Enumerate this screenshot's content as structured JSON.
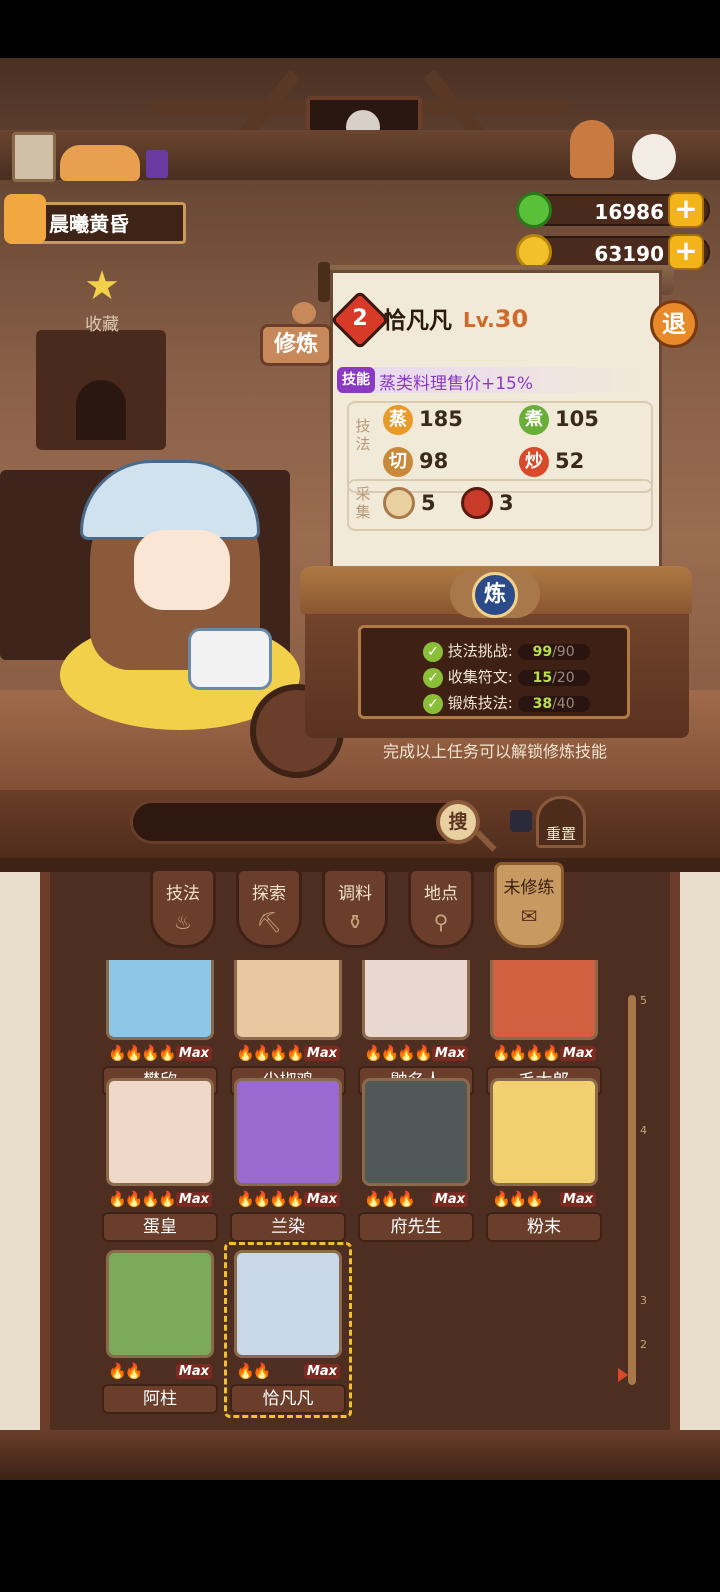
{
  "player": {
    "time_label": "晨曦黄昏"
  },
  "resources": {
    "jade": "16986",
    "coins": "63190",
    "add_symbol": "+"
  },
  "side": {
    "favorite_label": "收藏"
  },
  "header": {
    "train_tab": "修炼",
    "exit_label": "退"
  },
  "chef": {
    "rank": "2",
    "name": "恰凡凡",
    "level_prefix": "Lv.",
    "level": "30",
    "skill_tag": "技能",
    "skill_desc": "蒸类料理售价+15%",
    "technique_label": "技法",
    "collect_label": "采集",
    "stats": [
      {
        "glyph": "蒸",
        "value": "185",
        "color": "#e89a2a"
      },
      {
        "glyph": "煮",
        "value": "105",
        "color": "#6aae3a"
      },
      {
        "glyph": "切",
        "value": "98",
        "color": "#c88a3a"
      },
      {
        "glyph": "炒",
        "value": "52",
        "color": "#d84a2a"
      }
    ],
    "collect": [
      {
        "value": "5"
      },
      {
        "value": "3"
      }
    ]
  },
  "refine": {
    "button": "炼",
    "tasks": [
      {
        "label": "技法挑战:",
        "cur": "99",
        "max": "/90"
      },
      {
        "label": "收集符文:",
        "cur": "15",
        "max": "/20"
      },
      {
        "label": "锻炼技法:",
        "cur": "38",
        "max": "/40"
      }
    ],
    "hint": "完成以上任务可以解锁修炼技能"
  },
  "search": {
    "button": "搜",
    "reset": "重置"
  },
  "tabs": [
    {
      "label": "技法",
      "icon": "♨"
    },
    {
      "label": "探索",
      "icon": "⛏"
    },
    {
      "label": "调料",
      "icon": "⚱"
    },
    {
      "label": "地点",
      "icon": "⚲"
    },
    {
      "label": "未修练",
      "icon": "✉"
    }
  ],
  "rail_ticks": [
    "5",
    "4",
    "3",
    "2"
  ],
  "cards": [
    {
      "name": "樊欣",
      "flames": "🔥🔥🔥🔥",
      "max": "Max",
      "bg": "#8ec6e8"
    },
    {
      "name": "尖椒鸡",
      "flames": "🔥🔥🔥🔥",
      "max": "Max",
      "bg": "#e8c6a0"
    },
    {
      "name": "鼬名人",
      "flames": "🔥🔥🔥🔥",
      "max": "Max",
      "bg": "#e8d8d0"
    },
    {
      "name": "毛太郎",
      "flames": "🔥🔥🔥🔥",
      "max": "Max",
      "bg": "#d06040"
    },
    {
      "name": "蛋皇",
      "flames": "🔥🔥🔥🔥",
      "max": "Max",
      "bg": "#f0d8c8"
    },
    {
      "name": "兰染",
      "flames": "🔥🔥🔥🔥",
      "max": "Max",
      "bg": "#9a6ad0"
    },
    {
      "name": "府先生",
      "flames": "🔥🔥🔥",
      "max": "Max",
      "bg": "#505858"
    },
    {
      "name": "粉末",
      "flames": "🔥🔥🔥",
      "max": "Max",
      "bg": "#f2d070"
    },
    {
      "name": "阿柱",
      "flames": "🔥🔥",
      "max": "Max",
      "bg": "#7aaa5a"
    },
    {
      "name": "恰凡凡",
      "flames": "🔥🔥",
      "max": "Max",
      "bg": "#c8d8e8"
    }
  ]
}
